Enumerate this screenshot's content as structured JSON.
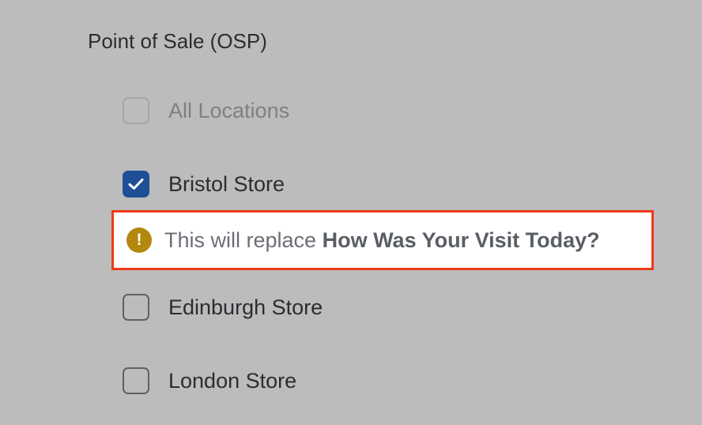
{
  "section": {
    "title": "Point of Sale (OSP)"
  },
  "locations": {
    "all": {
      "label": "All Locations",
      "checked": false,
      "disabled": true
    },
    "bristol": {
      "label": "Bristol Store",
      "checked": true
    },
    "edinburgh": {
      "label": "Edinburgh Store",
      "checked": false
    },
    "london": {
      "label": "London Store",
      "checked": false
    }
  },
  "warning": {
    "icon": "exclamation-circle-icon",
    "prefix": "This will replace",
    "survey_name": "How Was Your Visit Today?"
  },
  "colors": {
    "background": "#bcbcbc",
    "checkbox_checked": "#1f4f95",
    "warning_border": "#f03a17",
    "warning_icon": "#b4870f"
  }
}
